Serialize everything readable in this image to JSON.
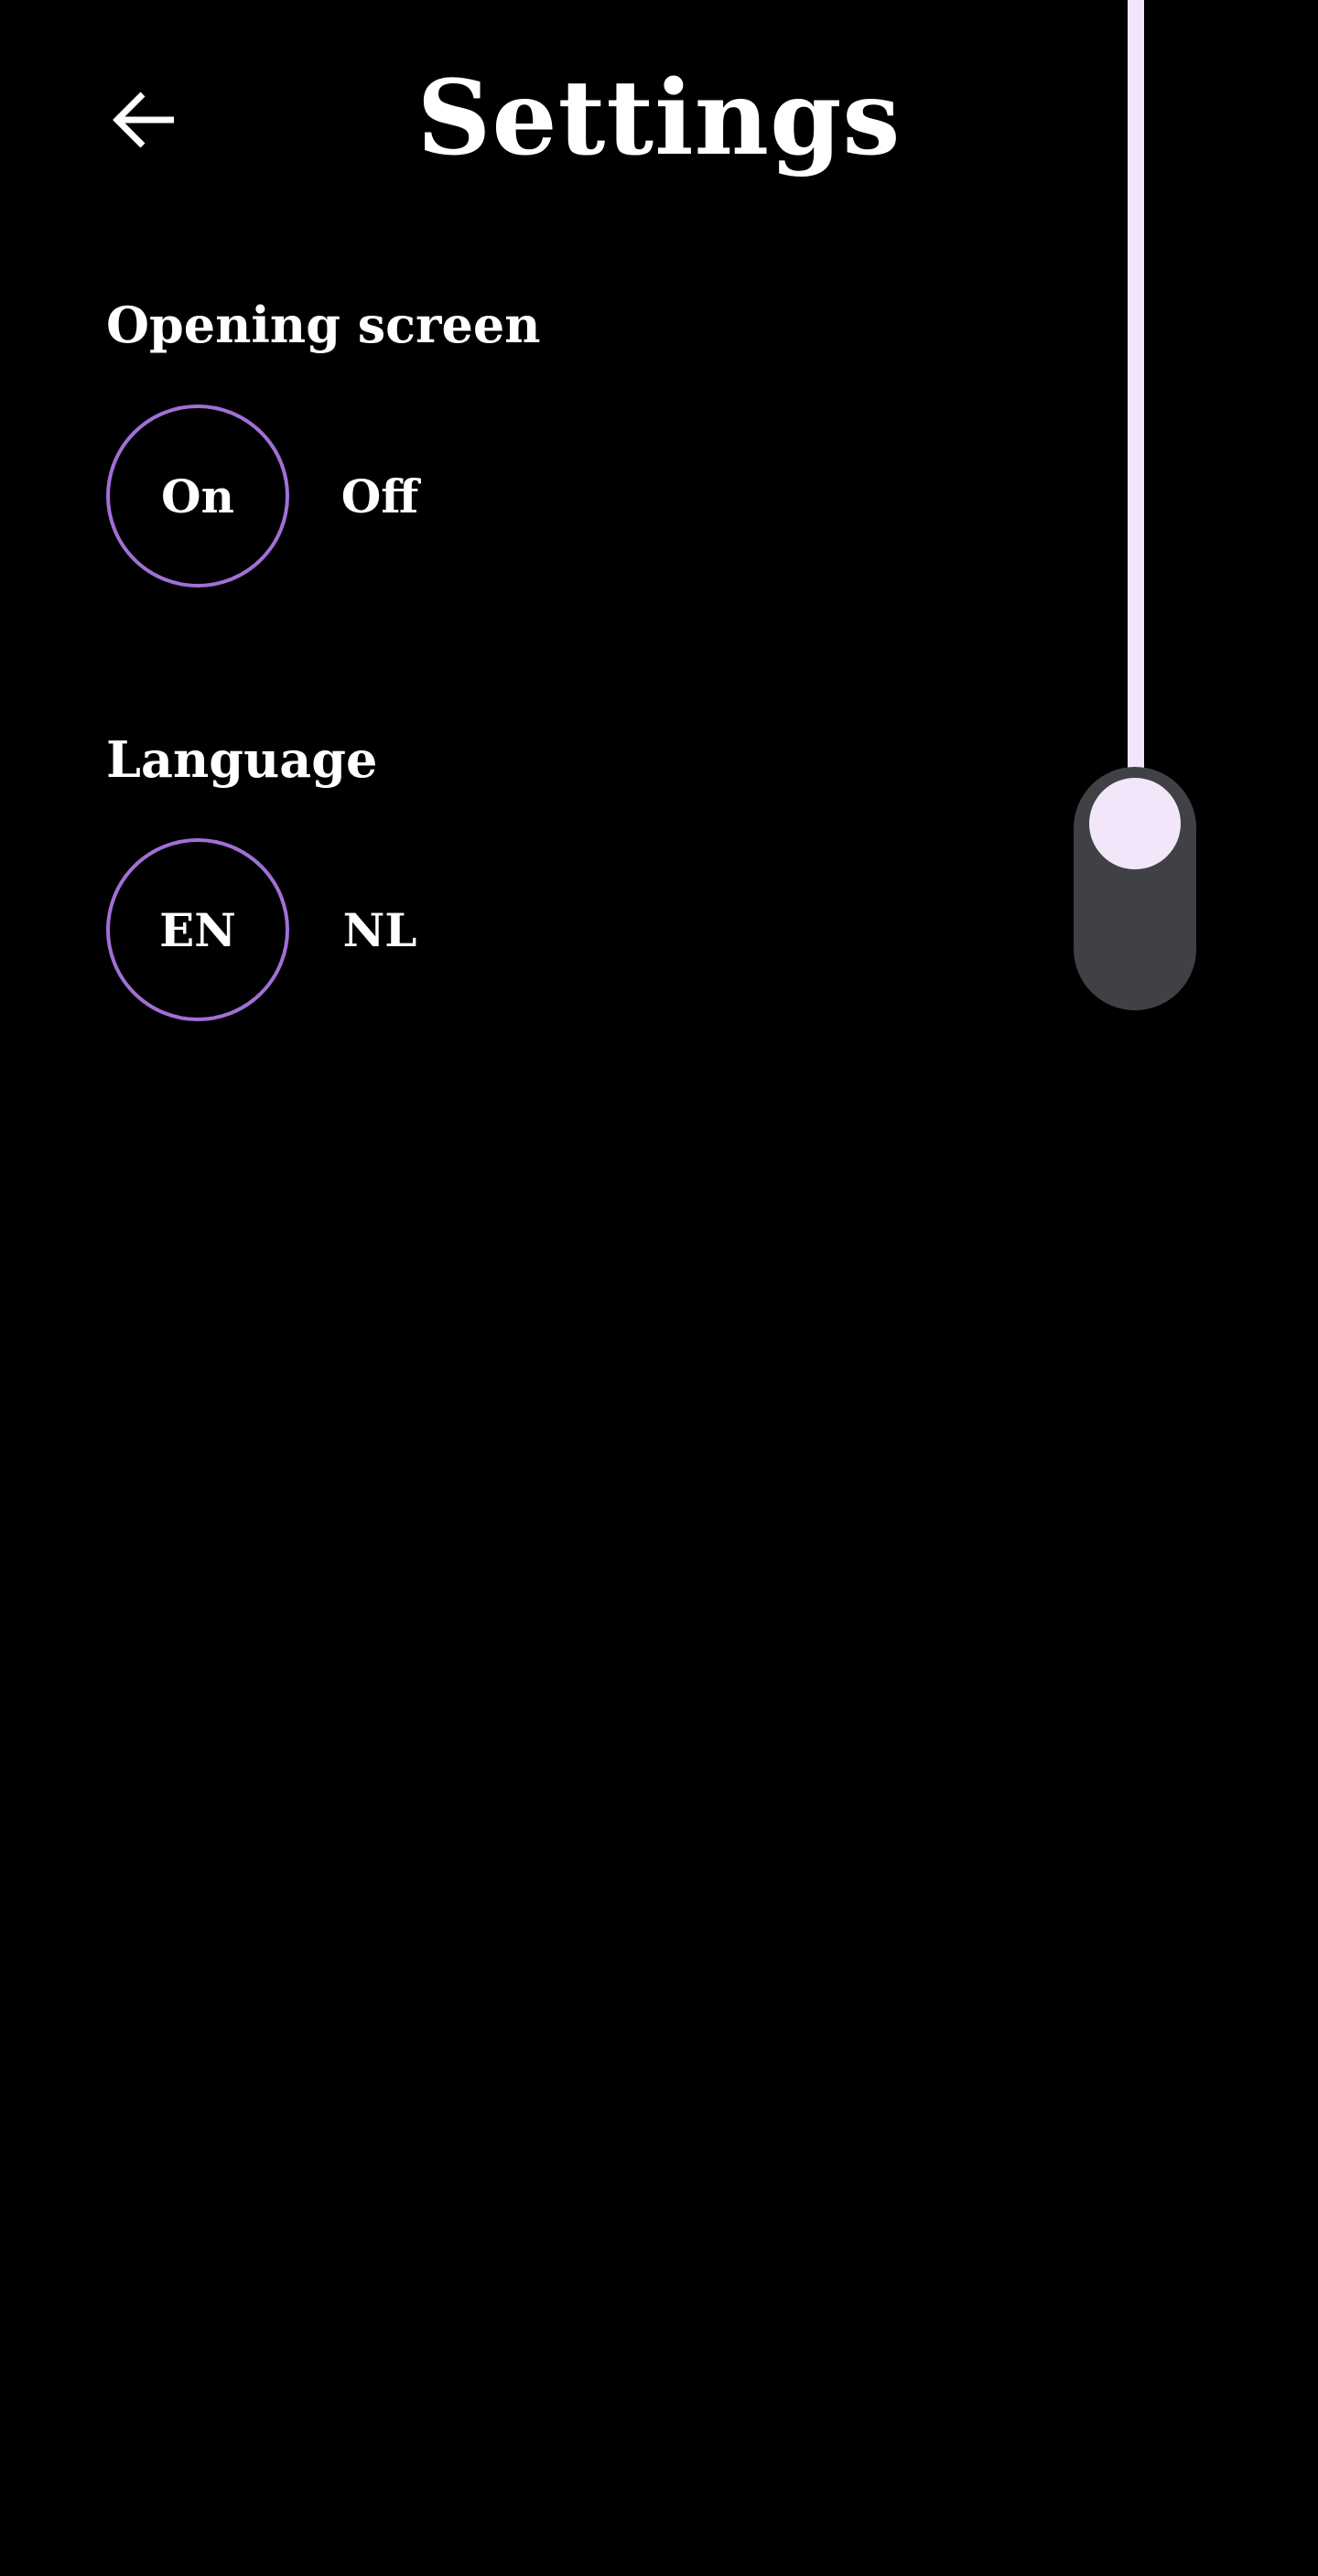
{
  "header": {
    "title": "Settings",
    "back_icon": "arrow-left-icon"
  },
  "opening_screen": {
    "label": "Opening screen",
    "options": [
      {
        "label": "On",
        "selected": true
      },
      {
        "label": "Off",
        "selected": false
      }
    ]
  },
  "language": {
    "label": "Language",
    "options": [
      {
        "label": "EN",
        "selected": true
      },
      {
        "label": "NL",
        "selected": false
      }
    ]
  },
  "pull_toggle": {
    "icon": "pull-cord-handle"
  },
  "colors": {
    "background": "#000000",
    "text": "#ffffff",
    "selected_ring": "#a070d6",
    "cord": "#f3e6fb",
    "handle": "#3f4145"
  }
}
